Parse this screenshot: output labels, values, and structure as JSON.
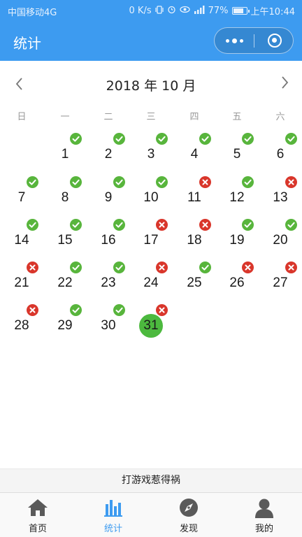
{
  "status_bar": {
    "carrier": "中国移动4G",
    "speed": "0 K/s",
    "battery": "77%",
    "battery_level": 0.77,
    "time": "上午10:44"
  },
  "header": {
    "title": "统计",
    "capsule_more_icon": "more-dots-icon",
    "capsule_close_icon": "target-circle-icon"
  },
  "calendar": {
    "month_title": "2018 年 10 月",
    "prev_icon": "chevron-left-icon",
    "next_icon": "chevron-right-icon",
    "weekdays": [
      "日",
      "一",
      "二",
      "三",
      "四",
      "五",
      "六"
    ],
    "first_weekday_index": 1,
    "today": 31,
    "days": [
      {
        "day": "1",
        "status": "ok"
      },
      {
        "day": "2",
        "status": "ok"
      },
      {
        "day": "3",
        "status": "ok"
      },
      {
        "day": "4",
        "status": "ok"
      },
      {
        "day": "5",
        "status": "ok"
      },
      {
        "day": "6",
        "status": "ok"
      },
      {
        "day": "7",
        "status": "ok"
      },
      {
        "day": "8",
        "status": "ok"
      },
      {
        "day": "9",
        "status": "ok"
      },
      {
        "day": "10",
        "status": "ok"
      },
      {
        "day": "11",
        "status": "fail"
      },
      {
        "day": "12",
        "status": "ok"
      },
      {
        "day": "13",
        "status": "fail"
      },
      {
        "day": "14",
        "status": "ok"
      },
      {
        "day": "15",
        "status": "ok"
      },
      {
        "day": "16",
        "status": "ok"
      },
      {
        "day": "17",
        "status": "fail"
      },
      {
        "day": "18",
        "status": "fail"
      },
      {
        "day": "19",
        "status": "ok"
      },
      {
        "day": "20",
        "status": "ok"
      },
      {
        "day": "21",
        "status": "fail"
      },
      {
        "day": "22",
        "status": "ok"
      },
      {
        "day": "23",
        "status": "ok"
      },
      {
        "day": "24",
        "status": "fail"
      },
      {
        "day": "25",
        "status": "ok"
      },
      {
        "day": "26",
        "status": "fail"
      },
      {
        "day": "27",
        "status": "fail"
      },
      {
        "day": "28",
        "status": "fail"
      },
      {
        "day": "29",
        "status": "ok"
      },
      {
        "day": "30",
        "status": "ok"
      },
      {
        "day": "31",
        "status": "fail"
      }
    ],
    "colors": {
      "ok": "#58b53c",
      "fail": "#d9362b",
      "today": "#4cb93e"
    }
  },
  "footer_note": "打游戏惹得祸",
  "tabbar": {
    "tabs": [
      {
        "label": "首页",
        "icon": "home-icon",
        "active": false
      },
      {
        "label": "统计",
        "icon": "bar-chart-icon",
        "active": true
      },
      {
        "label": "发现",
        "icon": "compass-icon",
        "active": false
      },
      {
        "label": "我的",
        "icon": "user-icon",
        "active": false
      }
    ],
    "active_color": "#3d9bf0"
  },
  "colors": {
    "brand": "#3d9bf0"
  }
}
